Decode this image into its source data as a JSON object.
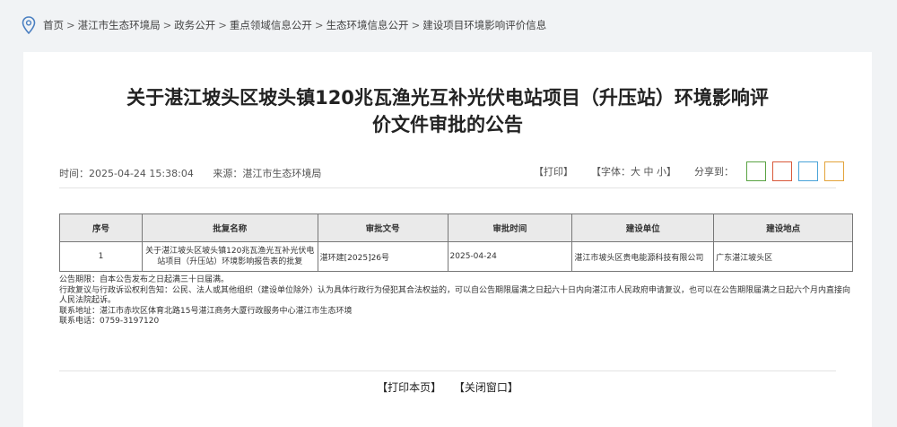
{
  "breadcrumb": {
    "items": [
      "首页",
      "湛江市生态环境局",
      "政务公开",
      "重点领域信息公开",
      "生态环境信息公开",
      "建设项目环境影响评价信息"
    ],
    "separator": ">"
  },
  "article": {
    "title_line1": "关于湛江坡头区坡头镇120兆瓦渔光互补光伏电站项目（升压站）环境影响评",
    "title_line2": "价文件审批的公告",
    "time": "时间：2025-04-24 15:38:04",
    "source": "来源：湛江市生态环境局"
  },
  "tools": {
    "print": "【打印】",
    "font_label": "【字体：大 中 小】",
    "share_label": "分享到：",
    "share_colors": [
      "#5aa343",
      "#d9593a",
      "#4aa3d8",
      "#e3a33a"
    ]
  },
  "table": {
    "headers": [
      "序号",
      "批复名称",
      "审批文号",
      "审批时间",
      "建设单位",
      "建设地点"
    ],
    "rows": [
      {
        "no": "1",
        "name": "关于湛江坡头区坡头镇120兆瓦渔光互补光伏电站项目（升压站）环境影响报告表的批复",
        "doc": "湛环建[2025]26号",
        "time": "2025-04-24",
        "unit": "湛江市坡头区贵电能源科技有限公司",
        "location": "广东湛江坡头区"
      }
    ]
  },
  "notice": {
    "line1": "公告期限：自本公告发布之日起满三十日届满。",
    "line2": "行政复议与行政诉讼权利告知：公民、法人或其他组织（建设单位除外）认为具体行政行为侵犯其合法权益的，可以自公告期限届满之日起六十日内向湛江市人民政府申请复议，也可以在公告期限届满之日起六个月内直接向人民法院起诉。",
    "line3": "联系地址：湛江市赤坎区体育北路15号湛江商务大厦行政服务中心湛江市生态环境",
    "line4": "联系电话：0759-3197120"
  },
  "footer": {
    "print_page": "【打印本页】",
    "close_window": "【关闭窗口】"
  }
}
